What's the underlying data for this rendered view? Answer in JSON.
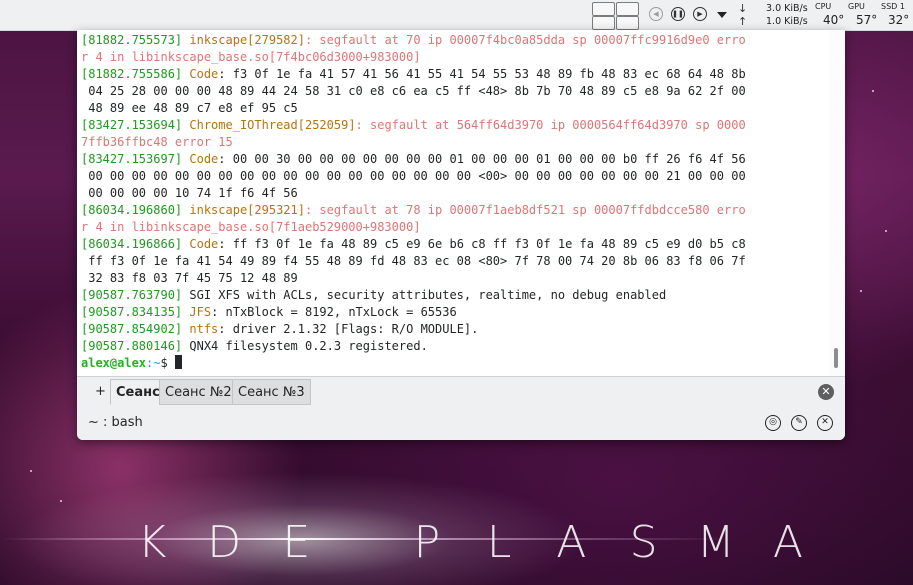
{
  "panel": {
    "media": {
      "prev_icon": "previous-track-icon",
      "pause_icon": "pause-icon",
      "next_icon": "next-track-icon",
      "menu_icon": "dropdown-arrow-icon"
    },
    "network": {
      "down_arrow": "↓",
      "up_arrow": "↑",
      "down_speed": "3.0 KiB/s",
      "up_speed": "1.0 KiB/s"
    },
    "monitors": [
      {
        "label": "CPU",
        "value": "40°"
      },
      {
        "label": "GPU",
        "value": "57°"
      },
      {
        "label": "SSD 1",
        "value": "32°"
      }
    ]
  },
  "terminal": {
    "lines": [
      [
        {
          "c": "ts",
          "t": "[81882.755573] "
        },
        {
          "c": "proc",
          "t": "inkscape[279582]"
        },
        {
          "c": "err",
          "t": ": segfault at 70 ip 00007f4bc0a85dda sp 00007ffc9916d9e0 erro"
        }
      ],
      [
        {
          "c": "err",
          "t": "r 4 in libinkscape_base.so[7f4bc06d3000+983000]"
        }
      ],
      [
        {
          "c": "ts",
          "t": "[81882.755586] "
        },
        {
          "c": "proc",
          "t": "Code"
        },
        {
          "c": "",
          "t": ": f3 0f 1e fa 41 57 41 56 41 55 41 54 55 53 48 89 fb 48 83 ec 68 64 48 8b"
        }
      ],
      [
        {
          "c": "",
          "t": " 04 25 28 00 00 00 48 89 44 24 58 31 c0 e8 c6 ea c5 ff <48> 8b 7b 70 48 89 c5 e8 9a 62 2f 00"
        }
      ],
      [
        {
          "c": "",
          "t": " 48 89 ee 48 89 c7 e8 ef 95 c5"
        }
      ],
      [
        {
          "c": "ts",
          "t": "[83427.153694] "
        },
        {
          "c": "proc",
          "t": "Chrome_IOThread[252059]"
        },
        {
          "c": "err",
          "t": ": segfault at 564ff64d3970 ip 0000564ff64d3970 sp 0000"
        }
      ],
      [
        {
          "c": "err",
          "t": "7ffb36ffbc48 error 15"
        }
      ],
      [
        {
          "c": "ts",
          "t": "[83427.153697] "
        },
        {
          "c": "proc",
          "t": "Code"
        },
        {
          "c": "",
          "t": ": 00 00 30 00 00 00 00 00 00 00 01 00 00 00 01 00 00 00 b0 ff 26 f6 4f 56"
        }
      ],
      [
        {
          "c": "",
          "t": " 00 00 00 00 00 00 00 00 00 00 00 00 00 00 00 00 00 00 <00> 00 00 00 00 00 00 00 21 00 00 00"
        }
      ],
      [
        {
          "c": "",
          "t": " 00 00 00 00 10 74 1f f6 4f 56"
        }
      ],
      [
        {
          "c": "ts",
          "t": "[86034.196860] "
        },
        {
          "c": "proc",
          "t": "inkscape[295321]"
        },
        {
          "c": "err",
          "t": ": segfault at 78 ip 00007f1aeb8df521 sp 00007ffdbdcce580 erro"
        }
      ],
      [
        {
          "c": "err",
          "t": "r 4 in libinkscape_base.so[7f1aeb529000+983000]"
        }
      ],
      [
        {
          "c": "ts",
          "t": "[86034.196866] "
        },
        {
          "c": "proc",
          "t": "Code"
        },
        {
          "c": "",
          "t": ": ff f3 0f 1e fa 48 89 c5 e9 6e b6 c8 ff f3 0f 1e fa 48 89 c5 e9 d0 b5 c8"
        }
      ],
      [
        {
          "c": "",
          "t": " ff f3 0f 1e fa 41 54 49 89 f4 55 48 89 fd 48 83 ec 08 <80> 7f 78 00 74 20 8b 06 83 f8 06 7f"
        }
      ],
      [
        {
          "c": "",
          "t": " 32 83 f8 03 7f 45 75 12 48 89"
        }
      ],
      [
        {
          "c": "ts",
          "t": "[90587.763790] "
        },
        {
          "c": "",
          "t": "SGI XFS with ACLs, security attributes, realtime, no debug enabled"
        }
      ],
      [
        {
          "c": "ts",
          "t": "[90587.834135] "
        },
        {
          "c": "proc",
          "t": "JFS"
        },
        {
          "c": "",
          "t": ": nTxBlock = 8192, nTxLock = 65536"
        }
      ],
      [
        {
          "c": "ts",
          "t": "[90587.854902] "
        },
        {
          "c": "proc",
          "t": "ntfs"
        },
        {
          "c": "",
          "t": ": driver 2.1.32 [Flags: R/O MODULE]."
        }
      ],
      [
        {
          "c": "ts",
          "t": "[90587.880146] "
        },
        {
          "c": "",
          "t": "QNX4 filesystem 0.2.3 registered."
        }
      ]
    ],
    "prompt": {
      "user_host": "alex@alex",
      "path": ":~",
      "symbol": "$ "
    }
  },
  "tabs": {
    "new_tab_label": "+",
    "items": [
      {
        "label": "Сеанс",
        "active": true
      },
      {
        "label": "Сеанс №2",
        "active": false
      },
      {
        "label": "Сеанс №3",
        "active": false
      }
    ],
    "close_icon": "close-circle-icon"
  },
  "status": {
    "text": "~ : bash",
    "icons": [
      "monitor-activity-icon",
      "settings-icon",
      "close-session-icon"
    ]
  },
  "wallpaper": {
    "logo_letters": [
      "K",
      "D",
      "E",
      "P",
      "L",
      "A",
      "S",
      "M",
      "A"
    ]
  }
}
